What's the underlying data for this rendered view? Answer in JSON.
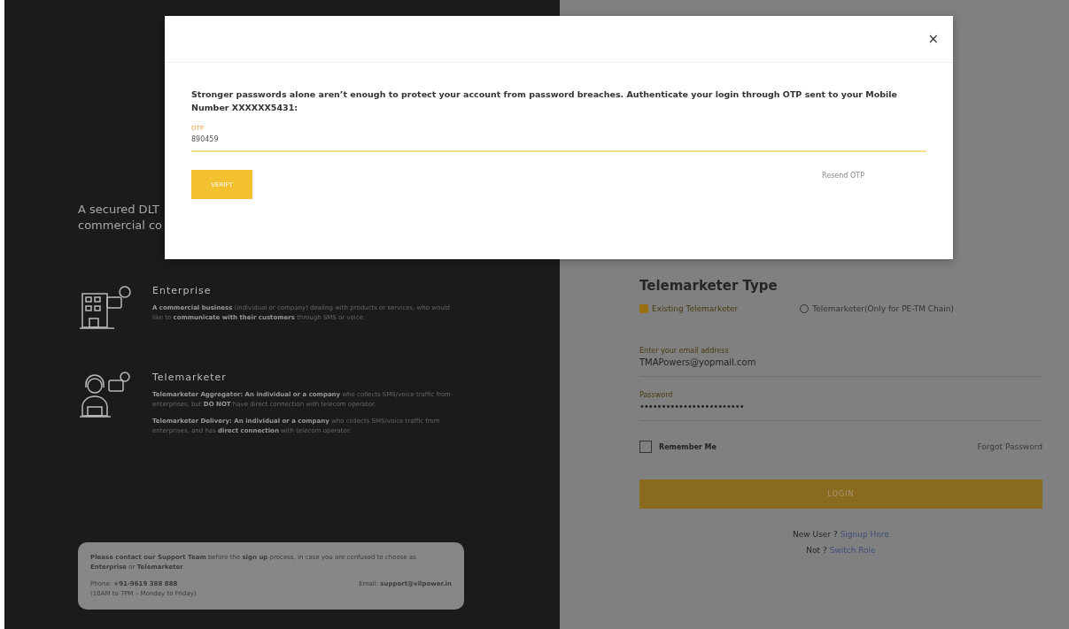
{
  "left_panel": {
    "heading_lines": [
      "A secured DLT",
      "commercial co"
    ],
    "sections": [
      {
        "kind": "enterprise",
        "title": "Enterprise",
        "paragraphs": [
          "**A commercial business** (individual or company) dealing with products or services, who would like to **communicate with their customers** through SMS or voice."
        ]
      },
      {
        "kind": "telemarketer",
        "title": "Telemarketer",
        "paragraphs": [
          "**Telemarketer Aggregator: An individual or a company** who collects SMS/voice traffic from enterprises, but **DO NOT** have direct connection with telecom operator.",
          "**Telemarketer Delivery: An individual or a company** who collects SMS/voice traffic from enterprises, and has **direct connection** with telecom operator."
        ]
      }
    ],
    "support_box": {
      "message": "**Please contact our Support Team** before the **sign up** process, in case you are confused to choose as **Enterprise** or **Telemarketer**.",
      "phone": "Phone: **+91-9619 388 888**",
      "hours": "(10AM to 7PM – Monday to Friday)",
      "email": "Email: **support@vilpower.in**"
    }
  },
  "login_form": {
    "type_label": "Telemarketer Type",
    "types": [
      {
        "label": "Existing Telemarketer",
        "selected": true
      },
      {
        "label": "Telemarketer(Only for PE-TM Chain)",
        "selected": false
      }
    ],
    "email": {
      "label": "Enter your email address",
      "value": "TMAPowers@yopmail.com"
    },
    "password": {
      "label": "Password",
      "value": "••••••••••••••••••••••••"
    },
    "remember_me": {
      "label": "Remember Me",
      "checked": false
    },
    "forgot_password": "Forgot Password",
    "login_button": "LOGIN",
    "signup": {
      "prompt": "New User ?",
      "link": "Signup Here"
    },
    "switch": {
      "prompt": "Not ?",
      "link": "Switch Role"
    }
  },
  "otp_dialog": {
    "close": "×",
    "message": "Stronger passwords alone aren’t enough to protect your account from password breaches. Authenticate your login through OTP sent to your Mobile Number XXXXXX5431:",
    "otp": {
      "label": "OTP",
      "value": "890459"
    },
    "verify_button": "VERIFY",
    "resend": "Resend OTP"
  }
}
